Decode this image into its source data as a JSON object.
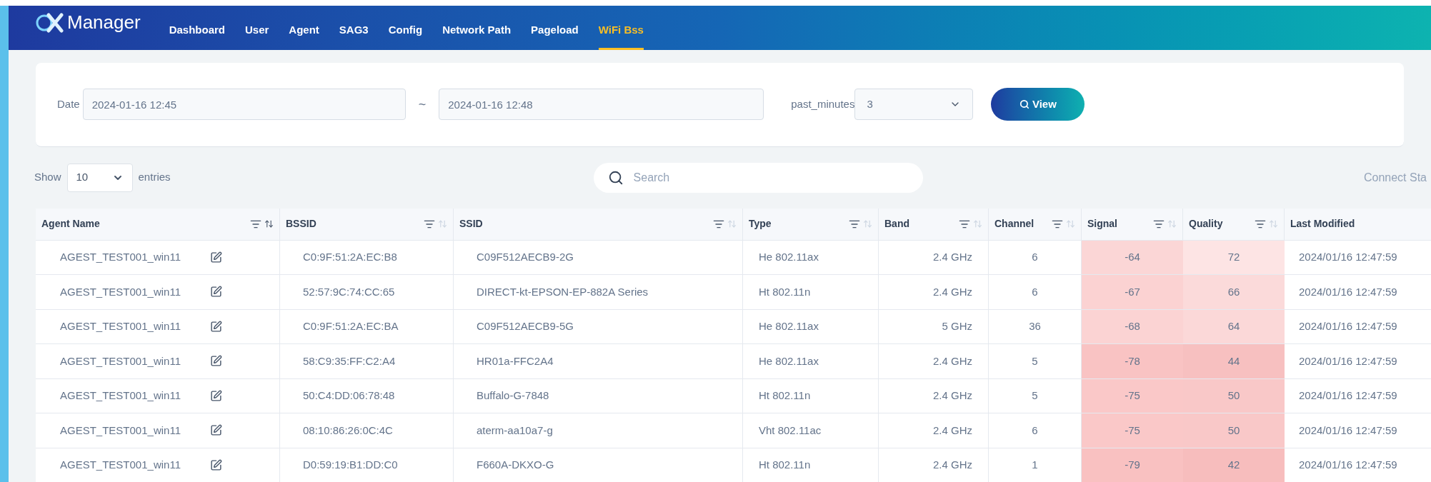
{
  "brand": {
    "name": "Manager"
  },
  "nav": [
    {
      "label": "Dashboard",
      "selected": false
    },
    {
      "label": "User",
      "selected": false
    },
    {
      "label": "Agent",
      "selected": false
    },
    {
      "label": "SAG3",
      "selected": false
    },
    {
      "label": "Config",
      "selected": false
    },
    {
      "label": "Network Path",
      "selected": false
    },
    {
      "label": "Pageload",
      "selected": false
    },
    {
      "label": "WiFi Bss",
      "selected": true
    }
  ],
  "filter": {
    "date_label": "Date",
    "date_from": "2024-01-16 12:45",
    "separator": "~",
    "date_to": "2024-01-16 12:48",
    "minutes_label": "past_minutes",
    "minutes_value": "3",
    "view_button": "View"
  },
  "table_controls": {
    "show_label": "Show",
    "page_size": "10",
    "entries_label": "entries",
    "search_placeholder": "Search",
    "connect_status": "Connect Sta"
  },
  "table": {
    "columns": [
      {
        "label": "Agent Name",
        "sort_active": true
      },
      {
        "label": "BSSID",
        "sort_active": false
      },
      {
        "label": "SSID",
        "sort_active": false
      },
      {
        "label": "Type",
        "sort_active": false
      },
      {
        "label": "Band",
        "sort_active": false
      },
      {
        "label": "Channel",
        "sort_active": false
      },
      {
        "label": "Signal",
        "sort_active": false
      },
      {
        "label": "Quality",
        "sort_active": false
      },
      {
        "label": "Last Modified"
      }
    ],
    "rows": [
      {
        "agent": "AGEST_TEST001_win11",
        "bssid": "C0:9F:51:2A:EC:B8",
        "ssid": "C09F512AECB9-2G",
        "type": "He 802.11ax",
        "band": "2.4 GHz",
        "channel": "6",
        "signal": {
          "text": "-64",
          "color": "#fbd6d6"
        },
        "quality": {
          "text": "72",
          "color": "#fde4e4"
        },
        "modified": "2024/01/16 12:47:59"
      },
      {
        "agent": "AGEST_TEST001_win11",
        "bssid": "52:57:9C:74:CC:65",
        "ssid": "DIRECT-kt-EPSON-EP-882A Series",
        "type": "Ht 802.11n",
        "band": "2.4 GHz",
        "channel": "6",
        "signal": {
          "text": "-67",
          "color": "#fbd2d2"
        },
        "quality": {
          "text": "66",
          "color": "#fbdada"
        },
        "modified": "2024/01/16 12:47:59"
      },
      {
        "agent": "AGEST_TEST001_win11",
        "bssid": "C0:9F:51:2A:EC:BA",
        "ssid": "C09F512AECB9-5G",
        "type": "He 802.11ax",
        "band": "5 GHz",
        "channel": "36",
        "signal": {
          "text": "-68",
          "color": "#fbd3d3"
        },
        "quality": {
          "text": "64",
          "color": "#fbd8d8"
        },
        "modified": "2024/01/16 12:47:59"
      },
      {
        "agent": "AGEST_TEST001_win11",
        "bssid": "58:C9:35:FF:C2:A4",
        "ssid": "HR01a-FFC2A4",
        "type": "He 802.11ax",
        "band": "2.4 GHz",
        "channel": "5",
        "signal": {
          "text": "-78",
          "color": "#f9c3c3"
        },
        "quality": {
          "text": "44",
          "color": "#f7c0c0"
        },
        "modified": "2024/01/16 12:47:59"
      },
      {
        "agent": "AGEST_TEST001_win11",
        "bssid": "50:C4:DD:06:78:48",
        "ssid": "Buffalo-G-7848",
        "type": "Ht 802.11n",
        "band": "2.4 GHz",
        "channel": "5",
        "signal": {
          "text": "-75",
          "color": "#fac8c8"
        },
        "quality": {
          "text": "50",
          "color": "#f9c8c8"
        },
        "modified": "2024/01/16 12:47:59"
      },
      {
        "agent": "AGEST_TEST001_win11",
        "bssid": "08:10:86:26:0C:4C",
        "ssid": "aterm-aa10a7-g",
        "type": "Vht 802.11ac",
        "band": "2.4 GHz",
        "channel": "6",
        "signal": {
          "text": "-75",
          "color": "#fac8c8"
        },
        "quality": {
          "text": "50",
          "color": "#f9c8c8"
        },
        "modified": "2024/01/16 12:47:59"
      },
      {
        "agent": "AGEST_TEST001_win11",
        "bssid": "D0:59:19:B1:DD:C0",
        "ssid": "F660A-DKXO-G",
        "type": "Ht 802.11n",
        "band": "2.4 GHz",
        "channel": "1",
        "signal": {
          "text": "-79",
          "color": "#f9c1c1"
        },
        "quality": {
          "text": "42",
          "color": "#f7bdbd"
        },
        "modified": "2024/01/16 12:47:59"
      }
    ]
  }
}
